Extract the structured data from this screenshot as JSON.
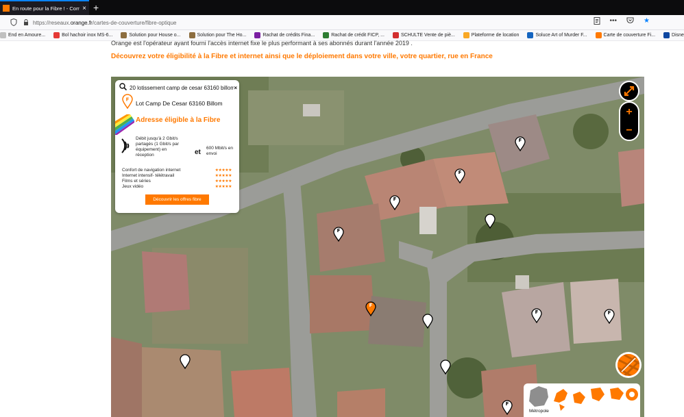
{
  "browser": {
    "tab_title": "En route pour la Fibre ! - Comm",
    "tab_close": "×",
    "new_tab": "+",
    "url_prefix": "https://reseaux.",
    "url_host": "orange.fr",
    "url_path": "/cartes-de-couverture/fibre-optique",
    "bookmarks": [
      {
        "label": "End en Amoure...",
        "color": "#c0c0c0"
      },
      {
        "label": "Bol hachoir inox MS-6...",
        "color": "#e53935"
      },
      {
        "label": "Solution pour House o...",
        "color": "#8d6e3f"
      },
      {
        "label": "Solution pour The Ho...",
        "color": "#8d6e3f"
      },
      {
        "label": "Rachat de crédits Fina...",
        "color": "#7b1fa2"
      },
      {
        "label": "Rachat de crédit FICP, ...",
        "color": "#2e7d32"
      },
      {
        "label": "SCHULTE Vente de piè...",
        "color": "#d32f2f"
      },
      {
        "label": "Plateforme de location",
        "color": "#f9a825"
      },
      {
        "label": "Soluce Art of Murder F...",
        "color": "#1565c0"
      },
      {
        "label": "Carte de couverture Fi...",
        "color": "#ff7900"
      },
      {
        "label": "Disney+ | Films et séries",
        "color": "#0d47a1"
      }
    ]
  },
  "page": {
    "intro_text": "Orange est l'opérateur ayant fourni l'accès internet fixe le plus performant à ses abonnés durant l'année 2019 .",
    "headline": "Découvrez votre éligibilité à la Fibre et internet ainsi que le déploiement dans votre ville, votre quartier, rue en France"
  },
  "panel": {
    "search_query": "20 lotissement camp de cesar 63160 billom",
    "search_clear": "×",
    "address": "Lot Camp De Cesar 63160 Billom",
    "eligibility": "Adresse éligible à la Fibre",
    "download": "Débit jusqu'à 2 Gbit/s partagés (1 Gbit/s par équipement) en réception",
    "and": "et",
    "upload": "600 Mbit/s en envoi",
    "ratings": [
      {
        "label": "Confort de navigation internet",
        "stars": "★★★★★"
      },
      {
        "label": "Internet intensif- télétravail",
        "stars": "★★★★★"
      },
      {
        "label": "Films et séries",
        "stars": "★★★★★"
      },
      {
        "label": "Jeux vidéo",
        "stars": "★★★★★"
      }
    ],
    "offer_button": "Découvrir les offres fibre"
  },
  "map": {
    "marker_letter": "F",
    "region_label": "Métropole",
    "accent_color": "#ff7900"
  }
}
